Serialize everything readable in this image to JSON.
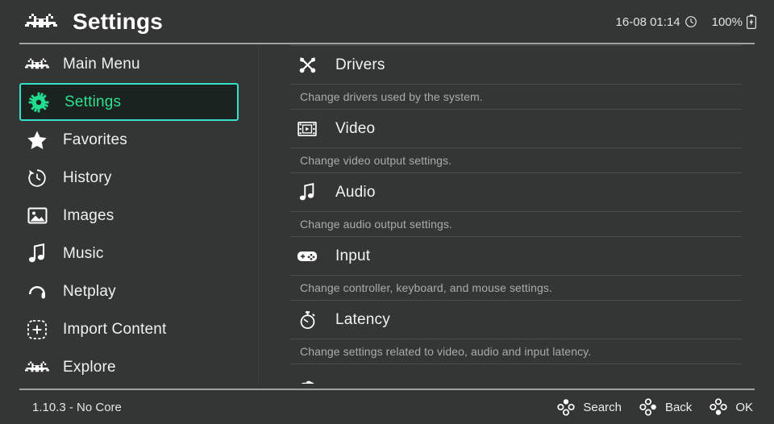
{
  "header": {
    "logo_icon": "retro-invader-icon",
    "title": "Settings",
    "clock": {
      "text": "16-08 01:14",
      "icon": "clock-icon"
    },
    "battery": {
      "text": "100%",
      "icon": "battery-icon"
    }
  },
  "sidebar": {
    "items": [
      {
        "label": "Main Menu",
        "icon": "retro-invader-icon",
        "selected": false
      },
      {
        "label": "Settings",
        "icon": "gear-icon",
        "selected": true
      },
      {
        "label": "Favorites",
        "icon": "star-icon",
        "selected": false
      },
      {
        "label": "History",
        "icon": "history-clock-icon",
        "selected": false
      },
      {
        "label": "Images",
        "icon": "image-icon",
        "selected": false
      },
      {
        "label": "Music",
        "icon": "music-note-icon",
        "selected": false
      },
      {
        "label": "Netplay",
        "icon": "netplay-headset-icon",
        "selected": false
      },
      {
        "label": "Import Content",
        "icon": "plus-square-icon",
        "selected": false
      },
      {
        "label": "Explore",
        "icon": "retro-invader-icon",
        "selected": false
      }
    ]
  },
  "main": {
    "entries": [
      {
        "label": "Drivers",
        "icon": "tools-icon",
        "description": "Change drivers used by the system."
      },
      {
        "label": "Video",
        "icon": "film-icon",
        "description": "Change video output settings."
      },
      {
        "label": "Audio",
        "icon": "music-note-icon",
        "description": "Change audio output settings."
      },
      {
        "label": "Input",
        "icon": "gamepad-icon",
        "description": "Change controller, keyboard, and mouse settings."
      },
      {
        "label": "Latency",
        "icon": "stopwatch-icon",
        "description": "Change settings related to video, audio and input latency."
      }
    ]
  },
  "footer": {
    "status": "1.10.3 - No Core",
    "actions": [
      {
        "label": "Search",
        "icon": "dpad-up-icon"
      },
      {
        "label": "Back",
        "icon": "dpad-right-icon"
      },
      {
        "label": "OK",
        "icon": "dpad-down-icon"
      }
    ]
  },
  "colors": {
    "background": "#333634",
    "selected_border": "#35e0c8",
    "selected_text": "#2fe08f",
    "selected_fill": "#1b2320",
    "divider": "#9fa3a0",
    "text_primary": "#f2f4f2",
    "text_secondary": "#a9aca9"
  }
}
